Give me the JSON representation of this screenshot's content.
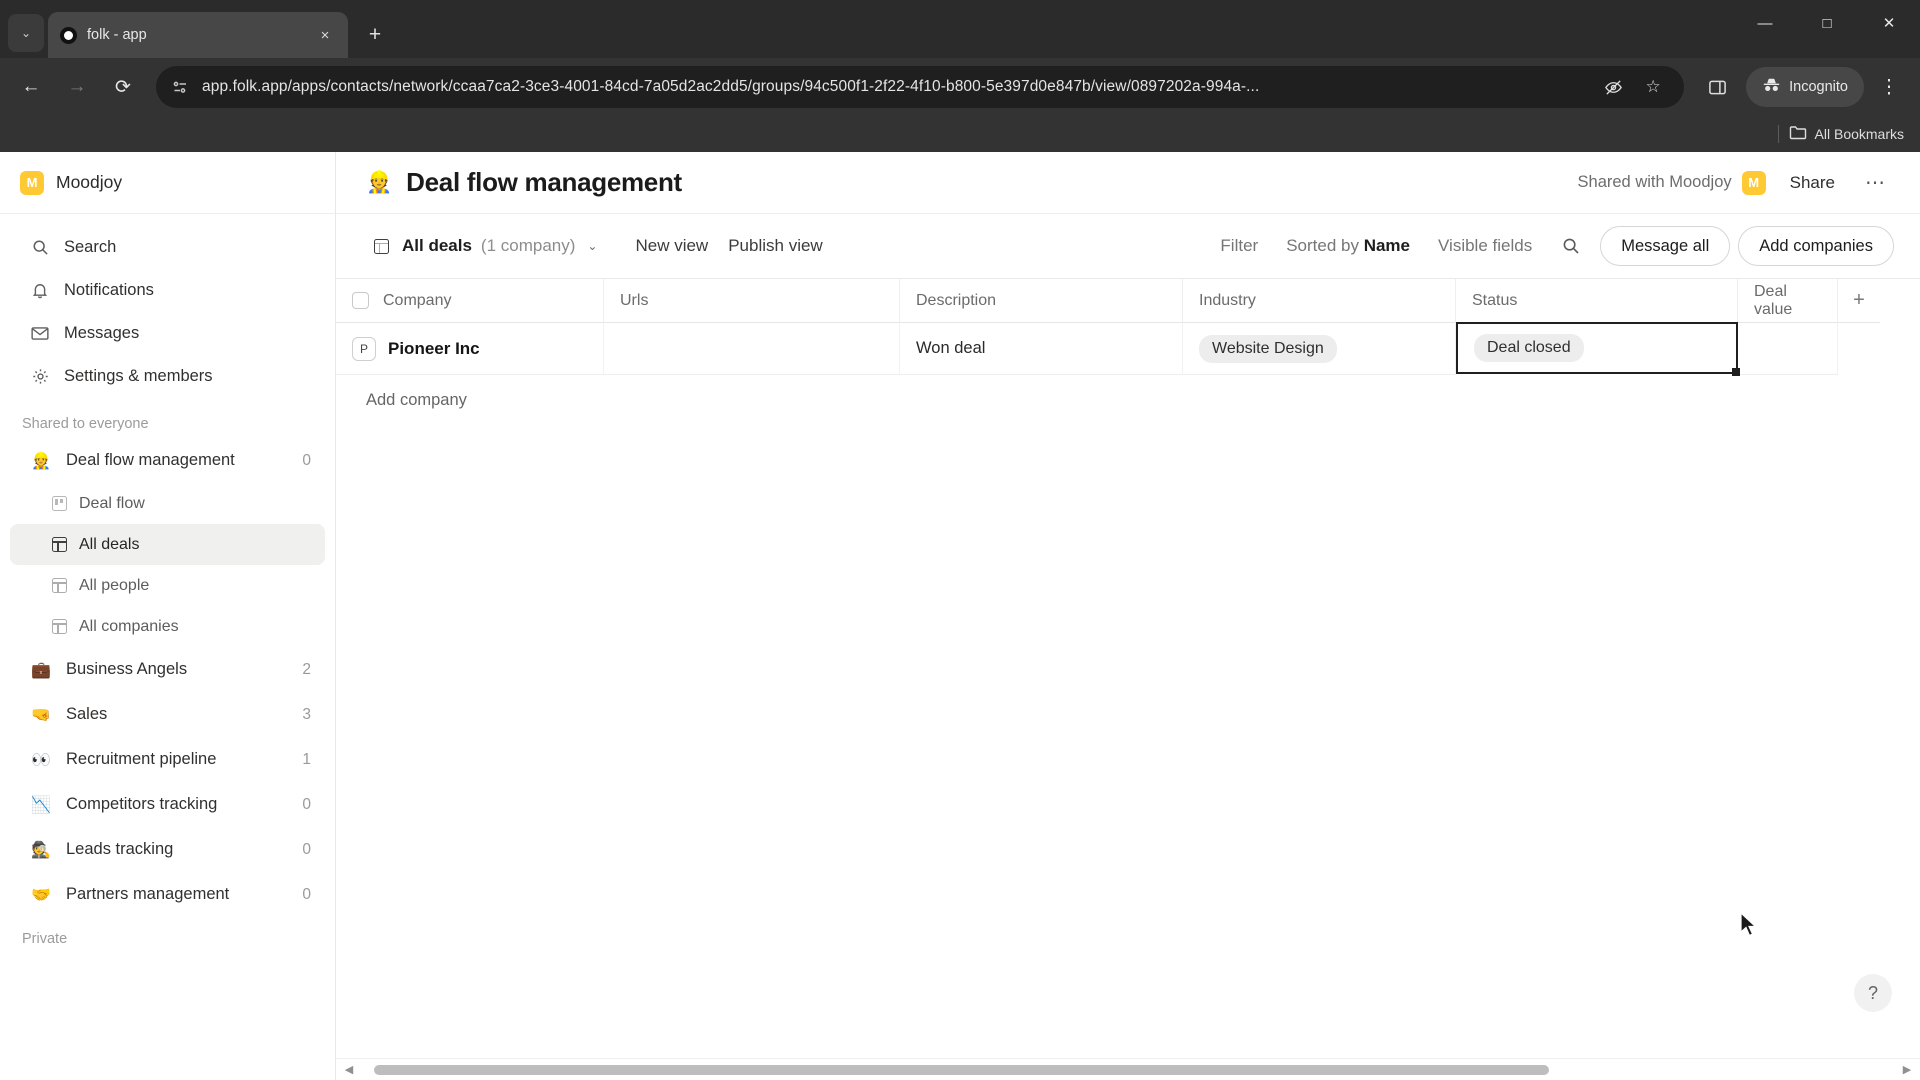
{
  "browser": {
    "tab": {
      "title": "folk - app",
      "favicon_icon": "folk-circle-icon",
      "close_icon": "×"
    },
    "tab_list_icon": "⌄",
    "new_tab_icon": "+",
    "window_controls": {
      "minimize": "—",
      "maximize": "□",
      "close": "✕"
    },
    "nav": {
      "back_icon": "←",
      "forward_icon": "→",
      "reload_icon": "⟳"
    },
    "omnibox": {
      "site_info_icon": "page-info-icon",
      "url": "app.folk.app/apps/contacts/network/ccaa7ca2-3ce3-4001-84cd-7a05d2ac2dd5/groups/94c500f1-2f22-4f10-b800-5e397d0e847b/view/0897202a-994a-...",
      "tracking_icon": "eye-off-icon",
      "bookmark_icon": "☆"
    },
    "side_panel_icon": "side-panel-icon",
    "incognito": {
      "label": "Incognito",
      "icon": "incognito-hat-icon"
    },
    "menu_icon": "⋮",
    "bookmarks": {
      "all_bookmarks_label": "All Bookmarks",
      "folder_icon": "folder-icon"
    }
  },
  "sidebar": {
    "workspace": {
      "name": "Moodjoy",
      "avatar_letter": "M",
      "avatar_color": "#FFC933"
    },
    "nav": [
      {
        "label": "Search",
        "icon": "search-icon"
      },
      {
        "label": "Notifications",
        "icon": "bell-icon"
      },
      {
        "label": "Messages",
        "icon": "envelope-icon"
      },
      {
        "label": "Settings & members",
        "icon": "gear-icon"
      }
    ],
    "section_label": "Shared to everyone",
    "groups": [
      {
        "label": "Deal flow management",
        "emoji": "👷",
        "count": "0",
        "expanded": true,
        "views": [
          {
            "label": "Deal flow",
            "icon": "kanban-icon",
            "active": false
          },
          {
            "label": "All deals",
            "icon": "table-icon",
            "active": true
          },
          {
            "label": "All people",
            "icon": "table-icon",
            "active": false
          },
          {
            "label": "All companies",
            "icon": "table-icon",
            "active": false
          }
        ]
      },
      {
        "label": "Business Angels",
        "emoji": "💼",
        "count": "2"
      },
      {
        "label": "Sales",
        "emoji": "🤜",
        "count": "3"
      },
      {
        "label": "Recruitment pipeline",
        "emoji": "👀",
        "count": "1"
      },
      {
        "label": "Competitors tracking",
        "emoji": "📉",
        "count": "0"
      },
      {
        "label": "Leads tracking",
        "emoji": "🕵️",
        "count": "0"
      },
      {
        "label": "Partners management",
        "emoji": "🤝",
        "count": "0"
      }
    ],
    "private_label": "Private"
  },
  "page": {
    "emoji": "👷",
    "title": "Deal flow management",
    "shared_with_label": "Shared with Moodjoy",
    "shared_avatar_letter": "M",
    "share_label": "Share",
    "more_icon": "⋯"
  },
  "toolbar": {
    "view_icon": "table-icon",
    "view_name": "All deals",
    "view_count": "(1 company)",
    "view_chevron": "⌄",
    "new_view_label": "New view",
    "publish_view_label": "Publish view",
    "filter_label": "Filter",
    "sorted_by_prefix": "Sorted by ",
    "sorted_by_field": "Name",
    "visible_fields_label": "Visible fields",
    "search_icon": "search-icon",
    "message_all_label": "Message all",
    "add_companies_label": "Add companies"
  },
  "table": {
    "columns": [
      "Company",
      "Urls",
      "Description",
      "Industry",
      "Status",
      "Deal value"
    ],
    "add_column_icon": "+",
    "rows": [
      {
        "company": "Pioneer Inc",
        "company_initial": "P",
        "urls": "",
        "description": "Won deal",
        "industry": "Website Design",
        "status": "Deal closed",
        "deal_value": "",
        "selected_cell": "status"
      }
    ],
    "add_company_label": "Add company"
  },
  "footer": {
    "help_icon": "?",
    "scroll_left_icon": "◀",
    "scroll_right_icon": "▶"
  }
}
